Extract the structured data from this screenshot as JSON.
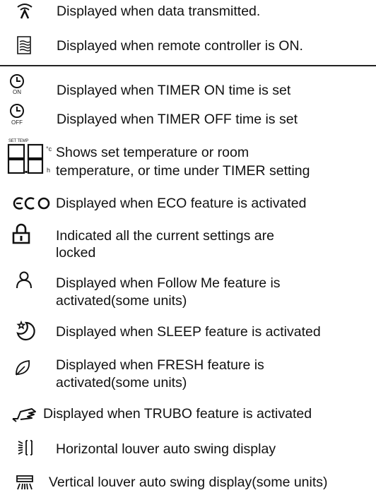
{
  "rows": [
    {
      "icon": "transmit-icon",
      "text": "Displayed when data transmitted."
    },
    {
      "icon": "remote-on-icon",
      "text": "Displayed when remote controller is ON."
    },
    {
      "icon": "timer-on-icon",
      "sub": "ON",
      "text": "Displayed when TIMER ON time is set"
    },
    {
      "icon": "timer-off-icon",
      "sub": "OFF",
      "text": "Displayed when TIMER OFF time is set"
    },
    {
      "icon": "temperature-display-icon",
      "label": "SET TEMP",
      "unit_c": "°c",
      "unit_h": "h",
      "text_line1": "Shows set temperature or room",
      "text_line2": "temperature, or time under TIMER setting"
    },
    {
      "icon": "eco-icon",
      "text": "Displayed when ECO feature is activated"
    },
    {
      "icon": "lock-icon",
      "text_line1": "Indicated all the current settings are",
      "text_line2": "locked"
    },
    {
      "icon": "follow-me-icon",
      "text_line1": "Displayed when Follow Me feature is",
      "text_line2": "activated(some units)"
    },
    {
      "icon": "sleep-icon",
      "text": "Displayed when SLEEP feature is activated"
    },
    {
      "icon": "fresh-icon",
      "text_line1": "Displayed when FRESH feature is",
      "text_line2": "activated(some units)"
    },
    {
      "icon": "turbo-icon",
      "text": "Displayed when TRUBO feature is activated"
    },
    {
      "icon": "horizontal-swing-icon",
      "text": "Horizontal louver auto swing display"
    },
    {
      "icon": "vertical-swing-icon",
      "text": "Vertical louver auto swing display(some units)"
    }
  ]
}
